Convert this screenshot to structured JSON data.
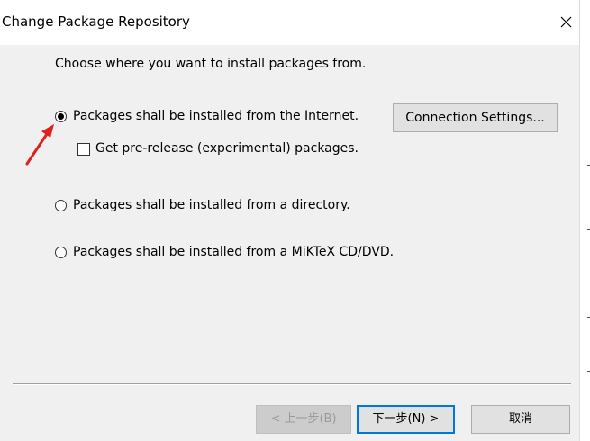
{
  "window": {
    "title": "Change Package Repository",
    "close_icon": "close-icon"
  },
  "instruction": "Choose where you want to install packages from.",
  "options": [
    {
      "label": "Packages shall be installed from the Internet.",
      "selected": true
    },
    {
      "label": "Packages shall be installed from a directory.",
      "selected": false
    },
    {
      "label": "Packages shall be installed from a MiKTeX CD/DVD.",
      "selected": false
    }
  ],
  "prerelease": {
    "label": "Get pre-release (experimental) packages.",
    "checked": false
  },
  "buttons": {
    "connection_settings": "Connection Settings...",
    "back": "< 上一步(B)",
    "next": "下一步(N) >",
    "cancel": "取消"
  },
  "annotation": {
    "icon": "red-arrow-icon",
    "color": "#e0201b"
  }
}
